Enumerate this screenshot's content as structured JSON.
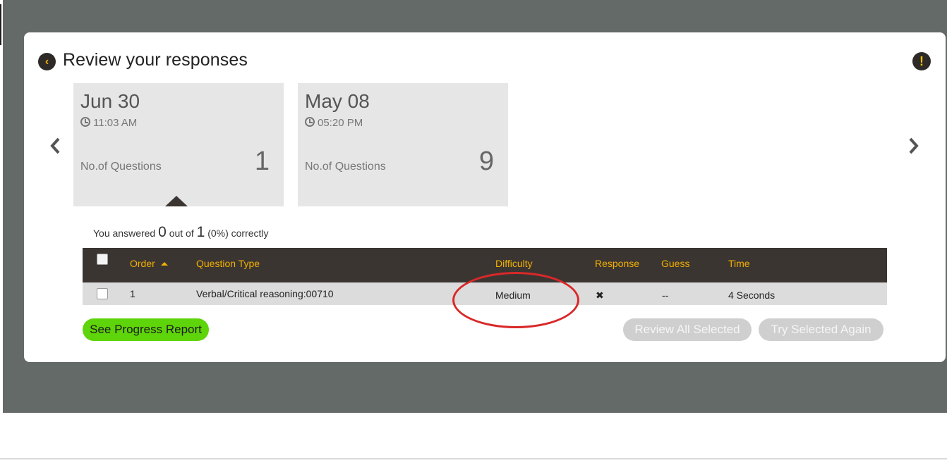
{
  "header": {
    "title": "Review your responses"
  },
  "sessions": [
    {
      "date": "Jun 30",
      "time": "11:03 AM",
      "label": "No.of Questions",
      "count": "1"
    },
    {
      "date": "May 08",
      "time": "05:20 PM",
      "label": "No.of Questions",
      "count": "9"
    }
  ],
  "summary": {
    "prefix": "You answered",
    "correct": "0",
    "middle": "out of",
    "total": "1",
    "suffix": "(0%) correctly"
  },
  "table": {
    "headers": [
      "Order",
      "Question Type",
      "Difficulty",
      "Response",
      "Guess",
      "Time"
    ],
    "rows": [
      {
        "order": "1",
        "question_type": "Verbal/Critical reasoning:00710",
        "difficulty": "Medium",
        "response": "✖",
        "guess": "--",
        "time": "4 Seconds"
      }
    ]
  },
  "buttons": {
    "progress": "See Progress Report",
    "review_all": "Review All Selected",
    "try_again": "Try Selected Again"
  },
  "icons": {
    "back": "back-icon",
    "alert": "alert-icon",
    "prev": "chevron-left-icon",
    "next": "chevron-right-icon",
    "clock": "clock-icon",
    "sort": "sort-ascending-icon"
  },
  "colors": {
    "accent": "#f3b100",
    "header_bg": "#3b3532",
    "progress_button": "#5ed40a",
    "disabled_button": "#cfcfcf",
    "annotation": "#d92828"
  }
}
